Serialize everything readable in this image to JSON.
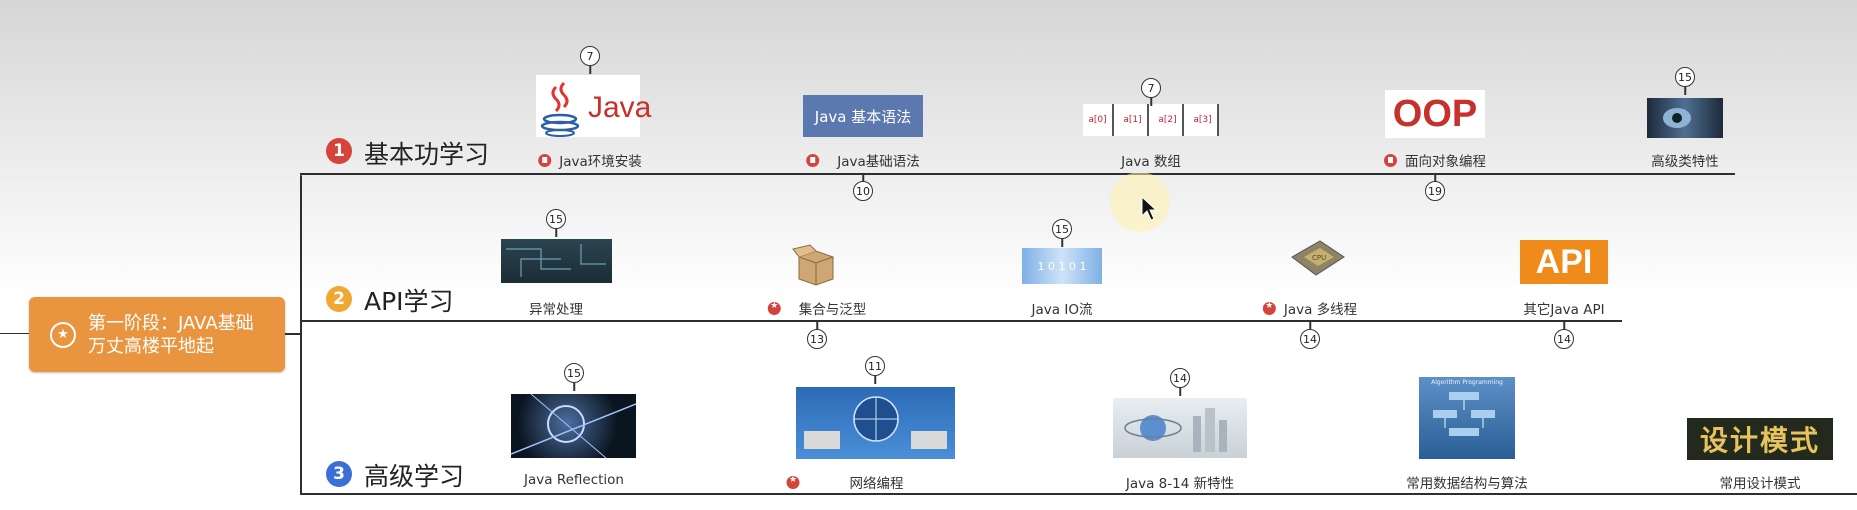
{
  "root": {
    "line1": "第一阶段：JAVA基础",
    "line2": "万丈高楼平地起"
  },
  "sections": [
    {
      "num": "1",
      "title": "基本功学习",
      "color": "#d6433a"
    },
    {
      "num": "2",
      "title": "API学习",
      "color": "#f1a833"
    },
    {
      "num": "3",
      "title": "高级学习",
      "color": "#3a6fd8"
    }
  ],
  "items": {
    "java_env": "Java环境安装",
    "java_syntax": "Java基础语法",
    "java_array": "Java 数组",
    "oop": "面向对象编程",
    "advanced_class": "高级类特性",
    "exception": "异常处理",
    "collections": "集合与泛型",
    "io": "Java IO流",
    "thread": "Java 多线程",
    "other_api": "其它Java API",
    "reflection": "Java Reflection",
    "network": "网络编程",
    "new_features": "Java 8-14 新特性",
    "datastruct": "常用数据结构与算法",
    "design_pattern": "常用设计模式"
  },
  "badges": {
    "java_env": "7",
    "java_array": "7",
    "advanced_class": "15",
    "java_syntax": "10",
    "oop": "19",
    "exception": "15",
    "io": "15",
    "collections": "13",
    "thread": "14",
    "other_api": "14",
    "reflection": "15",
    "network": "11",
    "new_features": "14"
  },
  "image_text": {
    "java_logo": "Java",
    "syntax_banner": "Java 基本语法",
    "array_cells": [
      "a[0]",
      "a[1]",
      "a[2]",
      "a[3]"
    ],
    "oop_logo": "OOP",
    "io_digits": "1 0 1 0 1",
    "cpu": "CPU",
    "api_logo": "API",
    "datastruct_label": "Algorithm Programming",
    "design_logo": "设计模式"
  }
}
